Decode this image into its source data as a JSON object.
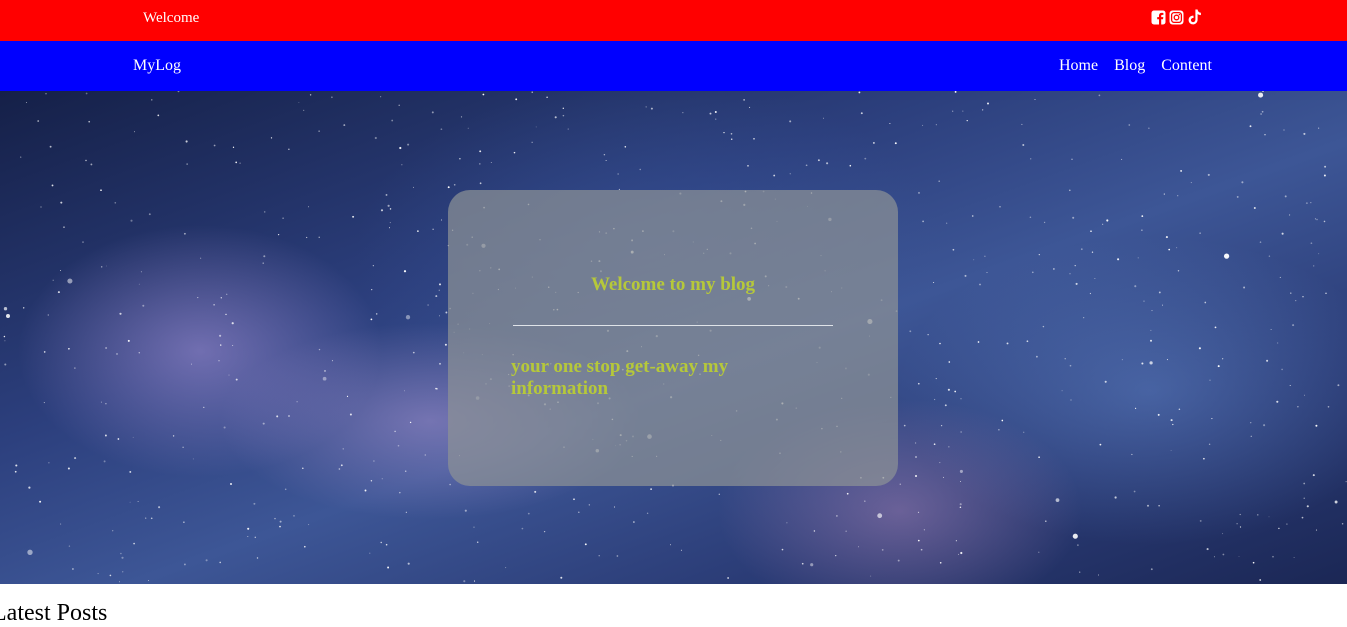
{
  "topbar": {
    "welcome_text": "Welcome",
    "background": "#ff0000",
    "social_icons": [
      "facebook-icon",
      "instagram-icon",
      "tiktok-icon"
    ]
  },
  "navbar": {
    "brand": "MyLog",
    "background": "#0000ff",
    "links": [
      "Home",
      "Blog",
      "Content"
    ]
  },
  "hero": {
    "background_image": "starry-night-sky",
    "card": {
      "title": "Welcome to my blog",
      "tagline": "your one stop get-away my information",
      "text_color": "#b6c83a"
    }
  },
  "section": {
    "title": "Latest Posts"
  }
}
